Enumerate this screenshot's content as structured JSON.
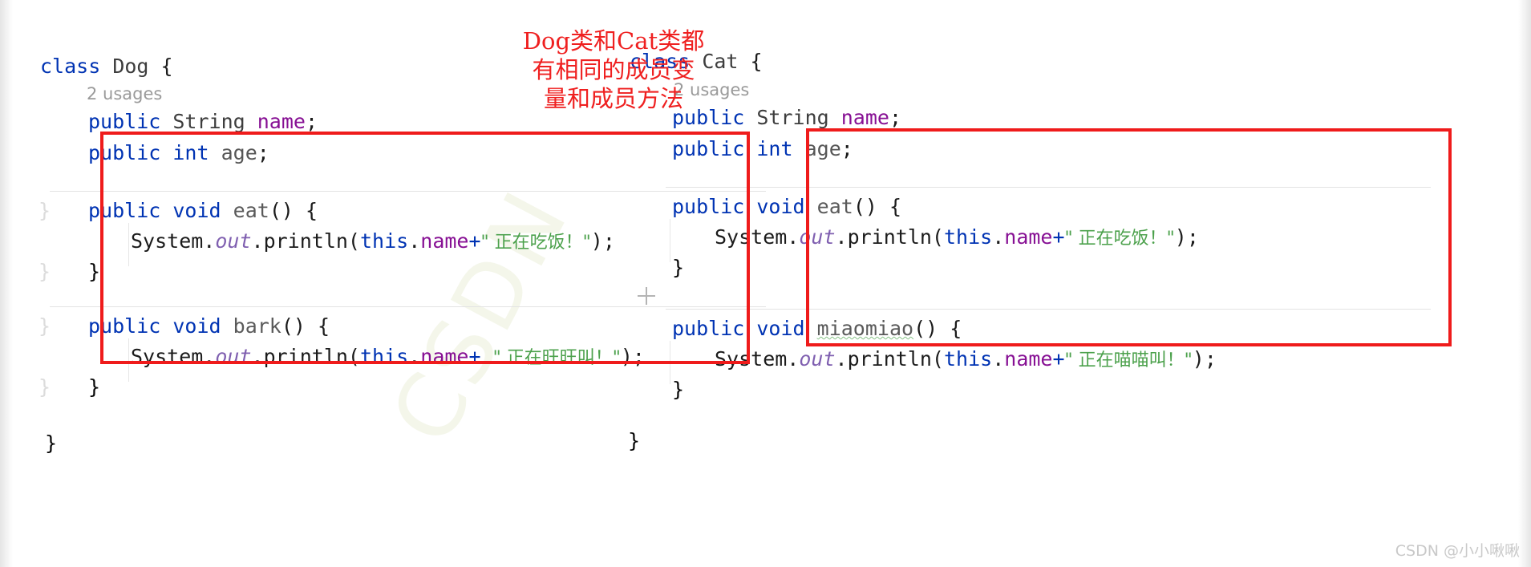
{
  "annotation": {
    "note_text": "Dog类和Cat类都\n有相同的成员变\n量和成员方法",
    "note_color": "#ef2020",
    "box_color": "#ef1b1b"
  },
  "watermark": {
    "corner": "CSDN @小小啾啾",
    "paper": "CSDN"
  },
  "editor": {
    "usages_hint": "2 usages",
    "plus_icon": "plus-icon"
  },
  "panes": [
    {
      "id": "dog",
      "class_declaration": {
        "keyword": "class",
        "name": "Dog",
        "brace": "{"
      },
      "usages": "2 usages",
      "members": [
        {
          "modifier": "public",
          "type": "String",
          "name": "name",
          "terminator": ";"
        },
        {
          "modifier": "public",
          "type": "int",
          "name": "age",
          "terminator": ";"
        }
      ],
      "methods": [
        {
          "modifier": "public",
          "returns": "void",
          "name": "eat",
          "signature": "() {",
          "body_prefix": "System.",
          "body_stat": "out",
          "body_call": ".println(",
          "body_this": "this",
          "body_dot": ".",
          "body_field": "name",
          "body_plus": "+",
          "body_string": "\" 正在吃饭！\"",
          "body_suffix": ");",
          "close": "}",
          "typo": false
        },
        {
          "modifier": "public",
          "returns": "void",
          "name": "bark",
          "signature": "() {",
          "body_prefix": "System.",
          "body_stat": "out",
          "body_call": ".println(",
          "body_this": "this",
          "body_dot": ".",
          "body_field": "name",
          "body_plus": "+ ",
          "body_string": "\" 正在旺旺叫！\"",
          "body_suffix": ");",
          "close": "}",
          "typo": false
        }
      ],
      "class_close": "}"
    },
    {
      "id": "cat",
      "class_declaration": {
        "keyword": "class",
        "name": "Cat",
        "brace": "{"
      },
      "usages": "2 usages",
      "members": [
        {
          "modifier": "public",
          "type": "String",
          "name": "name",
          "terminator": ";"
        },
        {
          "modifier": "public",
          "type": "int",
          "name": "age",
          "terminator": ";"
        }
      ],
      "methods": [
        {
          "modifier": "public",
          "returns": "void",
          "name": "eat",
          "signature": "() {",
          "body_prefix": "System.",
          "body_stat": "out",
          "body_call": ".println(",
          "body_this": "this",
          "body_dot": ".",
          "body_field": "name",
          "body_plus": "+",
          "body_string": "\" 正在吃饭！\"",
          "body_suffix": ");",
          "close": "}",
          "typo": false
        },
        {
          "modifier": "public",
          "returns": "void",
          "name": "miaomiao",
          "signature": "() {",
          "body_prefix": "System.",
          "body_stat": "out",
          "body_call": ".println(",
          "body_this": "this",
          "body_dot": ".",
          "body_field": "name",
          "body_plus": "+",
          "body_string": "\" 正在喵喵叫！\"",
          "body_suffix": ");",
          "close": "}",
          "typo": true
        }
      ],
      "class_close": "}"
    }
  ],
  "colors": {
    "keyword": "#0033B3",
    "field": "#871094",
    "string": "#4ca14c",
    "static_italic": "#7f5fb0",
    "hint_gray": "#9a9a9a",
    "separator": "#e3e3e3",
    "red_accent": "#ef1b1b"
  }
}
